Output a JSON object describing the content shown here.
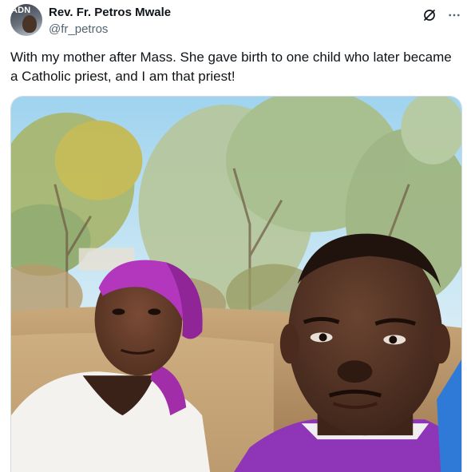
{
  "author": {
    "avatar_badge": "ADN",
    "display_name": "Rev. Fr. Petros Mwale",
    "handle": "@fr_petros"
  },
  "header_actions": {
    "grok_icon": "grok-icon",
    "more_icon": "more-icon"
  },
  "post": {
    "text": "With my mother after Mass. She gave birth to one child who later became a Catholic priest, and I am that priest!"
  },
  "media": {
    "type": "photo"
  },
  "colors": {
    "text_primary": "#0f1419",
    "text_secondary": "#536471",
    "border": "#cfd9de"
  }
}
